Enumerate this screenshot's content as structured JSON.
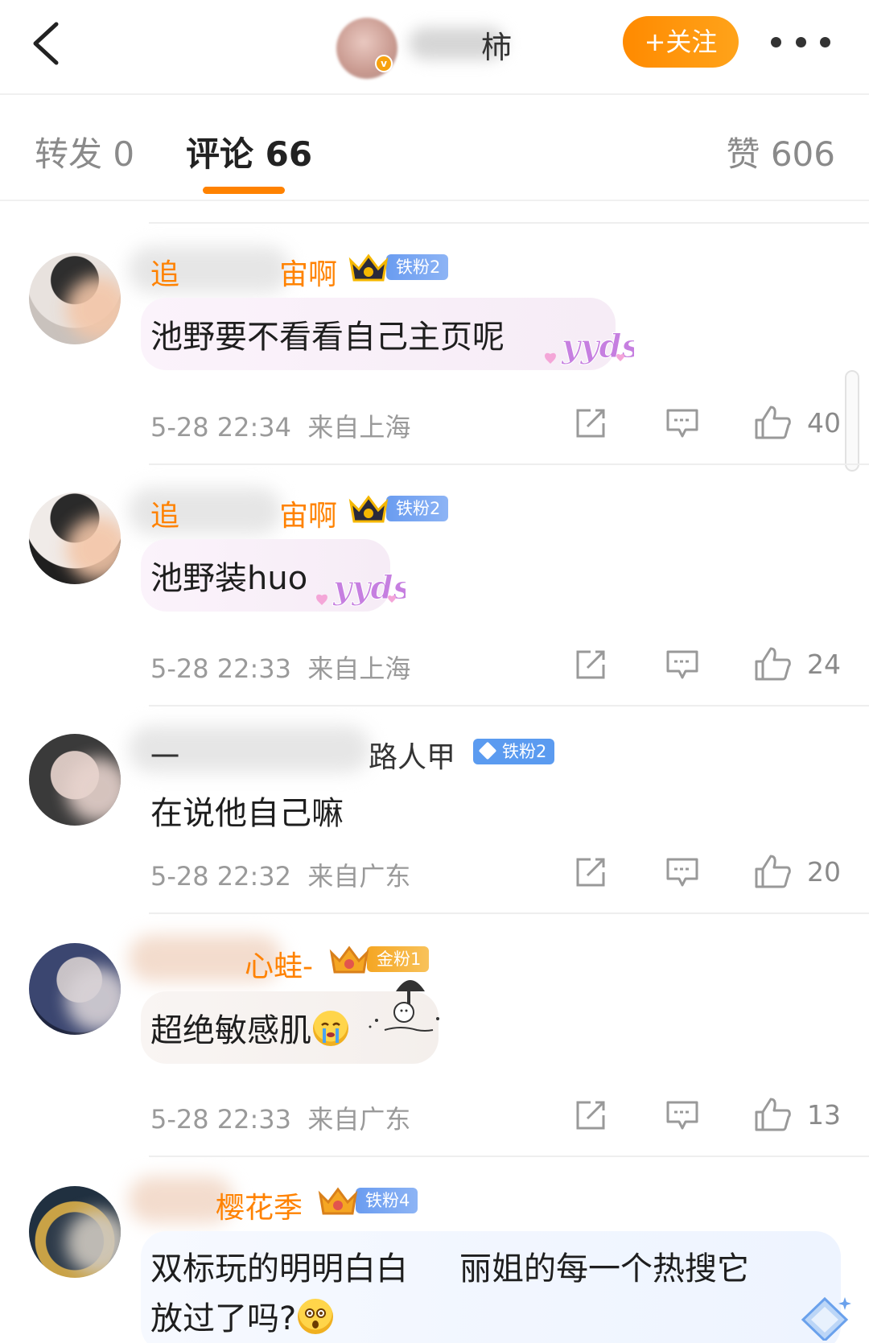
{
  "header": {
    "author_name": "柿",
    "follow_label": "+关注"
  },
  "tabs": [
    {
      "label": "转发 0"
    },
    {
      "label": "评论 66"
    },
    {
      "label": "赞 606"
    }
  ],
  "comments": [
    {
      "username": "追",
      "username_tail": "宙啊",
      "badge": "铁粉2",
      "text": "池野要不看看自己主页呢",
      "sticker": "yyds",
      "time": "5-28 22:34",
      "location": "来自上海",
      "likes": "40"
    },
    {
      "username": "追",
      "username_tail": "宙啊",
      "badge": "铁粉2",
      "text": "池野装huo",
      "sticker": "yyds",
      "time": "5-28 22:33",
      "location": "来自上海",
      "likes": "24"
    },
    {
      "username": "一",
      "username_tail": "路人甲",
      "badge": "铁粉2",
      "text": "在说他自己嘛",
      "time": "5-28 22:32",
      "location": "来自广东",
      "likes": "20"
    },
    {
      "username_tail": "心蛙-",
      "badge": "金粉1",
      "text": "超绝敏感肌",
      "time": "5-28 22:33",
      "location": "来自广东",
      "likes": "13"
    },
    {
      "username_tail": "樱花季",
      "badge": "铁粉4",
      "text_line1_a": "双标玩的明明白白",
      "text_line1_b": "丽姐的每一个热搜它",
      "text_line2": "放过了吗?"
    }
  ],
  "colors": {
    "accent": "#ff8200",
    "iron_badge": "#6a9cf0",
    "gold_badge": "#f5a623"
  }
}
